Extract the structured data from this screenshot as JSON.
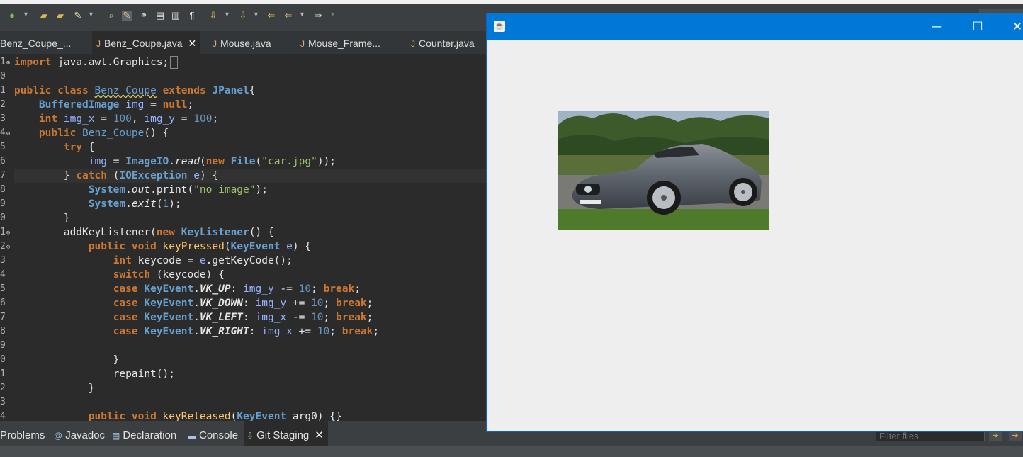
{
  "toolbar": {
    "icons": [
      "run-icon",
      "new-package-icon",
      "open-type-icon",
      "build-icon",
      "search-icon",
      "highlight-icon",
      "link-icon",
      "annotation-icon",
      "format-icon",
      "show-whitespace-icon",
      "pin-icon",
      "next-annotation-icon",
      "last-edit-icon",
      "back-icon",
      "forward-icon"
    ]
  },
  "editor_tabs": [
    {
      "label": "Benz_Coupe_...",
      "active": false
    },
    {
      "label": "Benz_Coupe.java",
      "active": true
    },
    {
      "label": "Mouse.java",
      "active": false
    },
    {
      "label": "Mouse_Frame...",
      "active": false
    },
    {
      "label": "Counter.java",
      "active": false
    }
  ],
  "gutter": [
    "1",
    "0",
    "1",
    "2",
    "3",
    "4",
    "5",
    "6",
    "7",
    "8",
    "9",
    "0",
    "1",
    "2",
    "3",
    "4",
    "5",
    "6",
    "7",
    "8",
    "9",
    "0",
    "1",
    "2",
    "3",
    "4"
  ],
  "code": [
    "import java.awt.Graphics;",
    "",
    "public class Benz_Coupe extends JPanel{",
    "    BufferedImage img = null;",
    "    int img_x = 100, img_y = 100;",
    "    public Benz_Coupe() {",
    "        try {",
    "            img = ImageIO.read(new File(\"car.jpg\"));",
    "        } catch (IOException e) {",
    "            System.out.print(\"no image\");",
    "            System.exit(1);",
    "        }",
    "        addKeyListener(new KeyListener() {",
    "            public void keyPressed(KeyEvent e) {",
    "                int keycode = e.getKeyCode();",
    "                switch (keycode) {",
    "                case KeyEvent.VK_UP: img_y -= 10; break;",
    "                case KeyEvent.VK_DOWN: img_y += 10; break;",
    "                case KeyEvent.VK_LEFT: img_x -= 10; break;",
    "                case KeyEvent.VK_RIGHT: img_x += 10; break;",
    "",
    "                }",
    "                repaint();",
    "            }",
    "",
    "            public void keyReleased(KeyEvent arg0) {}"
  ],
  "bottom_tabs": [
    {
      "label": "Problems",
      "icon": ""
    },
    {
      "label": "Javadoc",
      "icon": "@"
    },
    {
      "label": "Declaration",
      "icon": "declaration-icon"
    },
    {
      "label": "Console",
      "icon": "console-icon"
    },
    {
      "label": "Git Staging",
      "icon": "git-staging-icon",
      "active": true
    }
  ],
  "filter": {
    "placeholder": "Filter files"
  },
  "frame": {
    "title": "",
    "controls": {
      "minimize": "─",
      "maximize": "☐",
      "close": "✕"
    },
    "image": "car-photo"
  },
  "colors": {
    "titlebar": "#0078d7",
    "keyword": "#cc7832",
    "type": "#68a0d0",
    "number": "#6897bb",
    "string": "#9ec56a",
    "editor_bg": "#2b2b2b"
  }
}
